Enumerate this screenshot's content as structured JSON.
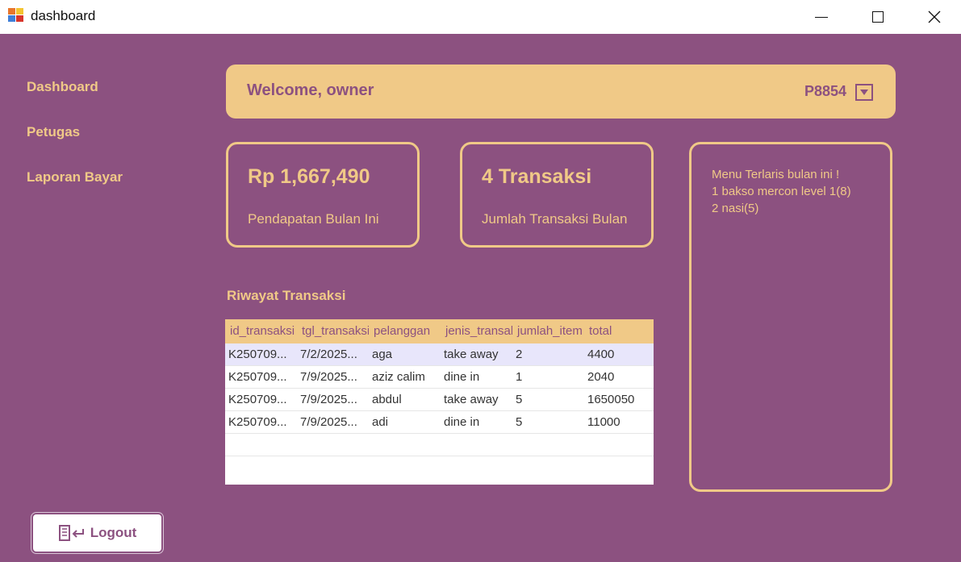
{
  "window": {
    "title": "dashboard"
  },
  "sidebar": {
    "items": [
      {
        "label": "Dashboard"
      },
      {
        "label": "Petugas"
      },
      {
        "label": "Laporan Bayar"
      }
    ],
    "logout_label": "Logout"
  },
  "header": {
    "welcome": "Welcome, owner",
    "user_code": "P8854"
  },
  "stats": {
    "revenue_value": "Rp 1,667,490",
    "revenue_label": "Pendapatan Bulan Ini",
    "transactions_value": "4 Transaksi",
    "transactions_label": "Jumlah Transaksi Bulan"
  },
  "top_menu": {
    "title": "Menu Terlaris bulan ini !",
    "items": [
      "1 bakso mercon level 1(8)",
      "2 nasi(5)"
    ]
  },
  "transactions": {
    "title": "Riwayat Transaksi",
    "columns": [
      "id_transaksi",
      "tgl_transaksi",
      "pelanggan",
      "jenis_transaksi",
      "jumlah_item",
      "total"
    ],
    "rows": [
      [
        "K250709...",
        "7/2/2025...",
        "aga",
        "take away",
        "2",
        "4400"
      ],
      [
        "K250709...",
        "7/9/2025...",
        "aziz calim",
        "dine in",
        "1",
        "2040"
      ],
      [
        "K250709...",
        "7/9/2025...",
        "abdul",
        "take away",
        "5",
        "1650050"
      ],
      [
        "K250709...",
        "7/9/2025...",
        "adi",
        "dine in",
        "5",
        "11000"
      ]
    ],
    "selected_row": 0
  },
  "colors": {
    "background": "#8c5180",
    "accent": "#f0c987",
    "selection": "#e8e6fb"
  }
}
